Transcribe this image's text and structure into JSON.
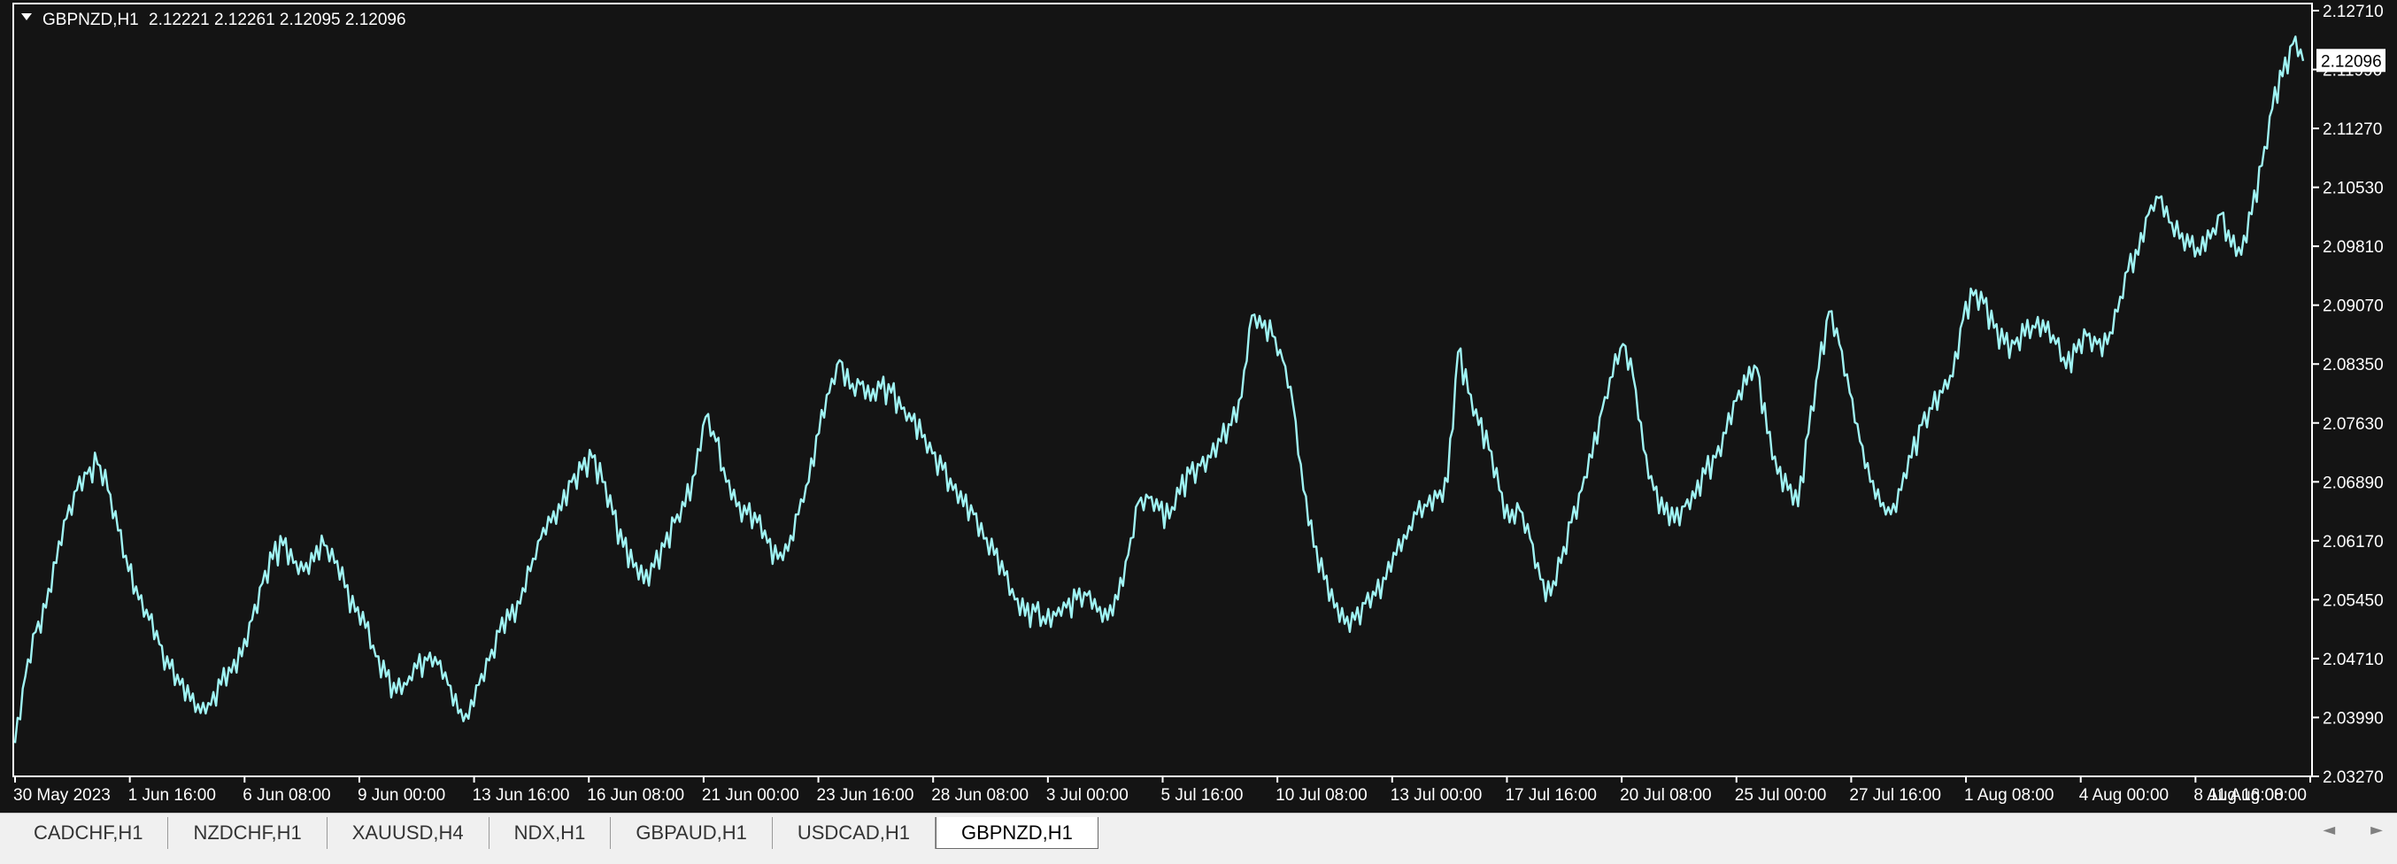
{
  "symbol_header": {
    "symbol": "GBPNZD,H1",
    "ohlc": "2.12221 2.12261 2.12095 2.12096",
    "icon": "triangle-down-icon"
  },
  "tabs": [
    {
      "label": "CADCHF,H1",
      "active": false
    },
    {
      "label": "NZDCHF,H1",
      "active": false
    },
    {
      "label": "XAUUSD,H4",
      "active": false
    },
    {
      "label": "NDX,H1",
      "active": false
    },
    {
      "label": "GBPAUD,H1",
      "active": false
    },
    {
      "label": "USDCAD,H1",
      "active": false
    },
    {
      "label": "GBPNZD,H1",
      "active": true
    }
  ],
  "scroll": {
    "left_icon": "◄",
    "right_icon": "►"
  },
  "colors": {
    "background": "#141414",
    "series": "#9ff3f3",
    "axis": "#ffffff",
    "tag_bg": "#ffffff",
    "tag_text": "#000000"
  },
  "chart_data": {
    "type": "line",
    "y_ticks": [
      "2.12710",
      "2.11990",
      "2.11270",
      "2.10530",
      "2.09810",
      "2.09070",
      "2.08350",
      "2.07630",
      "2.06890",
      "2.06170",
      "2.05450",
      "2.04710",
      "2.03990",
      "2.03270"
    ],
    "ylim": [
      2.0327,
      2.1271
    ],
    "x_ticks": [
      "30 May 2023",
      "1 Jun 16:00",
      "6 Jun 08:00",
      "9 Jun 00:00",
      "13 Jun 16:00",
      "16 Jun 08:00",
      "21 Jun 00:00",
      "23 Jun 16:00",
      "28 Jun 08:00",
      "3 Jul 00:00",
      "5 Jul 16:00",
      "10 Jul 08:00",
      "13 Jul 00:00",
      "17 Jul 16:00",
      "20 Jul 08:00",
      "25 Jul 00:00",
      "27 Jul 16:00",
      "1 Aug 08:00",
      "4 Aug 00:00",
      "8 Aug 16:00",
      "11 Aug 08:00"
    ],
    "last_price": "2.12096",
    "series": [
      {
        "values": [
          2.0368,
          2.045,
          2.0505,
          2.0535,
          2.059,
          2.0645,
          2.068,
          2.07,
          2.0712,
          2.068,
          2.063,
          2.058,
          2.0545,
          2.052,
          2.049,
          2.046,
          2.044,
          2.042,
          2.0405,
          2.0415,
          2.044,
          2.0455,
          2.0475,
          2.052,
          2.0565,
          2.0595,
          2.0612,
          2.059,
          2.058,
          2.0592,
          2.0612,
          2.059,
          2.056,
          2.053,
          2.051,
          2.0475,
          2.045,
          2.043,
          2.044,
          2.046,
          2.047,
          2.0465,
          2.044,
          2.0405,
          2.0398,
          2.044,
          2.047,
          2.0505,
          2.052,
          2.054,
          2.058,
          2.062,
          2.064,
          2.0655,
          2.069,
          2.0705,
          2.072,
          2.069,
          2.065,
          2.061,
          2.0585,
          2.0565,
          2.0585,
          2.061,
          2.064,
          2.066,
          2.07,
          2.077,
          2.074,
          2.069,
          2.066,
          2.065,
          2.064,
          2.0615,
          2.0595,
          2.0605,
          2.065,
          2.069,
          2.075,
          2.08,
          2.084,
          2.0805,
          2.081,
          2.079,
          2.0805,
          2.08,
          2.078,
          2.0765,
          2.0745,
          2.0725,
          2.0705,
          2.068,
          2.066,
          2.065,
          2.062,
          2.06,
          2.0575,
          2.0545,
          2.0525,
          2.053,
          2.0515,
          2.0525,
          2.0535,
          2.0545,
          2.055,
          2.053,
          2.052,
          2.0545,
          2.06,
          2.0665,
          2.067,
          2.0655,
          2.0645,
          2.0675,
          2.07,
          2.071,
          2.072,
          2.074,
          2.076,
          2.0795,
          2.0895,
          2.088,
          2.087,
          2.084,
          2.0785,
          2.068,
          2.061,
          2.057,
          2.0535,
          2.0515,
          2.052,
          2.054,
          2.055,
          2.057,
          2.06,
          2.062,
          2.065,
          2.066,
          2.067,
          2.069,
          2.085,
          2.08,
          2.076,
          2.073,
          2.068,
          2.064,
          2.0655,
          2.062,
          2.057,
          2.055,
          2.059,
          2.064,
          2.068,
          2.072,
          2.078,
          2.082,
          2.086,
          2.082,
          2.073,
          2.068,
          2.065,
          2.064,
          2.066,
          2.067,
          2.07,
          2.072,
          2.075,
          2.079,
          2.081,
          2.083,
          2.075,
          2.07,
          2.068,
          2.066,
          2.075,
          2.083,
          2.09,
          2.086,
          2.08,
          2.074,
          2.069,
          2.066,
          2.065,
          2.068,
          2.072,
          2.076,
          2.078,
          2.08,
          2.082,
          2.089,
          2.092,
          2.091,
          2.088,
          2.086,
          2.086,
          2.087,
          2.088,
          2.0875,
          2.086,
          2.083,
          2.085,
          2.087,
          2.086,
          2.086,
          2.09,
          2.095,
          2.097,
          2.102,
          2.104,
          2.101,
          2.099,
          2.098,
          2.097,
          2.099,
          2.102,
          2.098,
          2.097,
          2.102,
          2.108,
          2.115,
          2.119,
          2.123,
          2.1209
        ]
      }
    ]
  }
}
